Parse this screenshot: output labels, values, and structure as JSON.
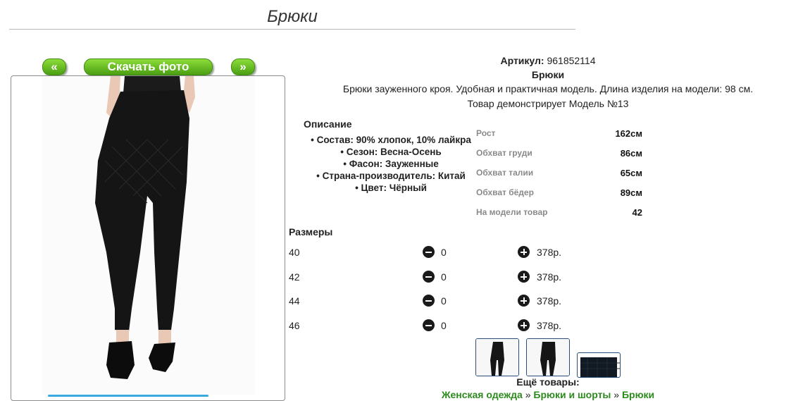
{
  "page": {
    "title": "Брюки"
  },
  "gallery": {
    "prev_label": "«",
    "download_label": "Скачать фото",
    "next_label": "»"
  },
  "product": {
    "article_label": "Артикул:",
    "article_value": "961852114",
    "name": "Брюки",
    "description": "Брюки зауженного кроя. Удобная и практичная модель. Длина изделия на модели: 98 см.",
    "model_line": "Товар демонстрирует Модель №13"
  },
  "details": {
    "heading": "Описание",
    "items": [
      "• Состав: 90% хлопок, 10% лайкра",
      "• Сезон: Весна-Осень",
      "• Фасон: Зауженные",
      "• Страна-производитель: Китай",
      "• Цвет: Чёрный"
    ]
  },
  "measurements": [
    {
      "label": "Рост",
      "value": "162см"
    },
    {
      "label": "Обхват груди",
      "value": "86см"
    },
    {
      "label": "Обхват талии",
      "value": "65см"
    },
    {
      "label": "Обхват бёдер",
      "value": "89см"
    },
    {
      "label": "На модели товар",
      "value": "42"
    }
  ],
  "sizes": {
    "heading": "Размеры",
    "rows": [
      {
        "size": "40",
        "qty": "0",
        "price": "378р."
      },
      {
        "size": "42",
        "qty": "0",
        "price": "378р."
      },
      {
        "size": "44",
        "qty": "0",
        "price": "378р."
      },
      {
        "size": "46",
        "qty": "0",
        "price": "378р."
      }
    ]
  },
  "more": {
    "heading": "Ещё товары:",
    "crumbs": [
      "Женская одежда",
      "Брюки и шорты",
      "Брюки"
    ],
    "separator": "»"
  },
  "colors": {
    "button_green": "#5cb21f",
    "link_green": "#2d8a1e",
    "thumb_border": "#2a4e7a"
  }
}
